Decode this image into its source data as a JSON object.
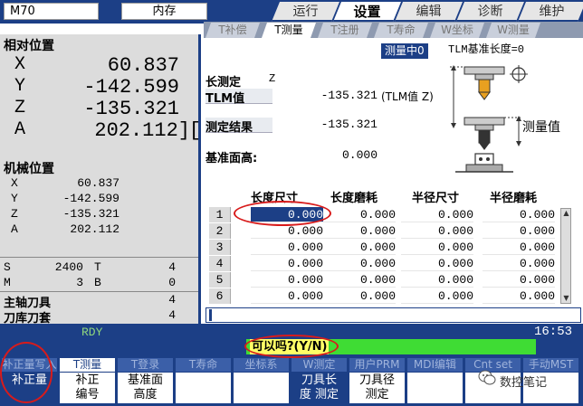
{
  "header": {
    "model": "M70",
    "memory": "内存",
    "tabs": [
      {
        "label": "运行",
        "active": false
      },
      {
        "label": "设置",
        "active": true
      },
      {
        "label": "编辑",
        "active": false
      },
      {
        "label": "诊断",
        "active": false
      },
      {
        "label": "维护",
        "active": false
      }
    ]
  },
  "left": {
    "relative_title": "相对位置",
    "relative": [
      {
        "axis": "X",
        "value": "60.837"
      },
      {
        "axis": "Y",
        "value": "-142.599"
      },
      {
        "axis": "Z",
        "value": "-135.321"
      },
      {
        "axis": "A",
        "value": "202.112]"
      }
    ],
    "relative_bracket": "[",
    "machine_title": "机械位置",
    "machine": [
      {
        "axis": "X",
        "value": "60.837"
      },
      {
        "axis": "Y",
        "value": "-142.599"
      },
      {
        "axis": "Z",
        "value": "-135.321"
      },
      {
        "axis": "A",
        "value": "202.112"
      }
    ],
    "status": [
      {
        "k1": "S",
        "v1": "2400",
        "k2": "T",
        "v2": "4"
      },
      {
        "k1": "M",
        "v1": "3",
        "k2": "B",
        "v2": "0"
      }
    ],
    "spindle_tool_label": "主轴刀具",
    "spindle_tool_value": "4",
    "magazine_tool_label": "刀库刀套",
    "magazine_tool_value": "4"
  },
  "subtabs": [
    {
      "label": "T补偿",
      "active": false
    },
    {
      "label": "T测量",
      "active": true
    },
    {
      "label": "T注册",
      "active": false
    },
    {
      "label": "T寿命",
      "active": false
    },
    {
      "label": "W坐标",
      "active": false
    },
    {
      "label": "W测量",
      "active": false
    }
  ],
  "measure": {
    "active_label": "测量中0",
    "tlm_ref": "TLM基准长度=0",
    "length_meas_label": "长测定",
    "axis": "Z",
    "tlm_label": "TLM值",
    "tlm_value": "-135.321",
    "tlm_note": "(TLM值 Z)",
    "result_label": "测定结果",
    "result_value": "-135.321",
    "base_height_label": "基准面高:",
    "base_height_value": "0.000",
    "diagram_label": "测量值"
  },
  "table": {
    "headers": [
      "长度尺寸",
      "长度磨耗",
      "半径尺寸",
      "半径磨耗"
    ],
    "rows": [
      {
        "idx": "1",
        "cells": [
          "0.000",
          "0.000",
          "0.000",
          "0.000"
        ]
      },
      {
        "idx": "2",
        "cells": [
          "0.000",
          "0.000",
          "0.000",
          "0.000"
        ]
      },
      {
        "idx": "3",
        "cells": [
          "0.000",
          "0.000",
          "0.000",
          "0.000"
        ]
      },
      {
        "idx": "4",
        "cells": [
          "0.000",
          "0.000",
          "0.000",
          "0.000"
        ]
      },
      {
        "idx": "5",
        "cells": [
          "0.000",
          "0.000",
          "0.000",
          "0.000"
        ]
      },
      {
        "idx": "6",
        "cells": [
          "0.000",
          "0.000",
          "0.000",
          "0.000"
        ]
      }
    ],
    "input_value": ""
  },
  "status": {
    "ready": "RDY",
    "time": "16:53",
    "message": "可以吗?(Y/N)"
  },
  "softkeys": [
    {
      "top": "补正量写入",
      "bottom": "补正量",
      "top_on": false,
      "bottom_sel": true
    },
    {
      "top": "T测量",
      "bottom": "补正\n编号",
      "top_on": true,
      "bottom_sel": false
    },
    {
      "top": "T登录",
      "bottom": "基准面\n高度",
      "top_on": false,
      "bottom_sel": false
    },
    {
      "top": "T寿命",
      "bottom": "",
      "top_on": false,
      "bottom_sel": false
    },
    {
      "top": "坐标系",
      "bottom": "",
      "top_on": false,
      "bottom_sel": false
    },
    {
      "top": "W测定",
      "bottom": "刀具长\n度 测定",
      "top_on": false,
      "bottom_sel": true
    },
    {
      "top": "用户PRM",
      "bottom": "刀具径\n测定",
      "top_on": false,
      "bottom_sel": false
    },
    {
      "top": "MDI编辑",
      "bottom": "",
      "top_on": false,
      "bottom_sel": false
    },
    {
      "top": "Cnt set",
      "bottom": "",
      "top_on": false,
      "bottom_sel": false
    },
    {
      "top": "手动MST",
      "bottom": "",
      "top_on": false,
      "bottom_sel": false
    }
  ],
  "watermark": "数控笔记",
  "colors": {
    "panel": "#1c3f86",
    "message": "#3fdc34",
    "annotation": "#d81b1b"
  }
}
